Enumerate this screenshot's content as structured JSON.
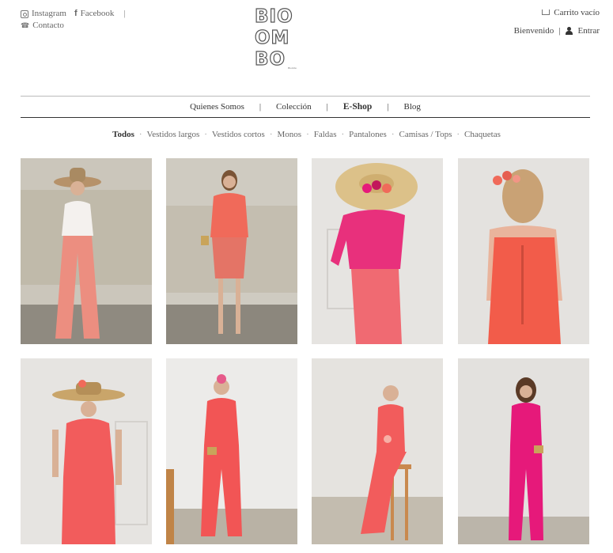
{
  "social": {
    "instagram_label": "Instagram",
    "facebook_label": "Facebook",
    "separator": "|",
    "contact_label": "Contacto"
  },
  "brand": {
    "line1": "BIO",
    "line2": "OM",
    "line3": "BO",
    "sub": "Biombo"
  },
  "account": {
    "cart_label": "Carrito vacío",
    "welcome_label": "Bienvenido",
    "separator": "|",
    "login_label": "Entrar"
  },
  "nav": {
    "items": [
      {
        "label": "Quienes Somos"
      },
      {
        "label": "Colección"
      },
      {
        "label": "E-Shop"
      },
      {
        "label": "Blog"
      }
    ],
    "separator": "|"
  },
  "filters": {
    "dot": "·",
    "items": [
      {
        "label": "Todos"
      },
      {
        "label": "Vestidos largos"
      },
      {
        "label": "Vestidos cortos"
      },
      {
        "label": "Monos"
      },
      {
        "label": "Faldas"
      },
      {
        "label": "Pantalones"
      },
      {
        "label": "Camisas / Tops"
      },
      {
        "label": "Chaquetas"
      }
    ]
  },
  "products": [
    {
      "id": "p1",
      "outfit": "coral-wide-trousers"
    },
    {
      "id": "p2",
      "outfit": "ruffle-top-skirt"
    },
    {
      "id": "p3",
      "outfit": "pink-blouse-hat"
    },
    {
      "id": "p4",
      "outfit": "coral-slip-back"
    },
    {
      "id": "p5",
      "outfit": "coral-dress-hat"
    },
    {
      "id": "p6",
      "outfit": "coral-jumpsuit"
    },
    {
      "id": "p7",
      "outfit": "coral-gown-stool"
    },
    {
      "id": "p8",
      "outfit": "fuchsia-jumpsuit"
    }
  ],
  "colors": {
    "coral": "#f06a5a",
    "pink": "#e84a78",
    "fuchsia": "#e6197a",
    "rule": "#333333"
  }
}
